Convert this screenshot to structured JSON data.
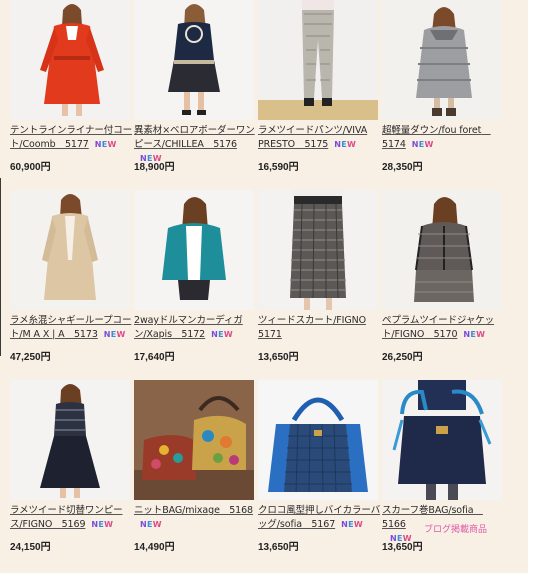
{
  "badge_text": "NEW",
  "colors": {
    "background": "#f8efe5",
    "link_text": "#2a2a2a",
    "new_badge": "#6a52c4",
    "blog_note": "#e05aa7"
  },
  "products": [
    {
      "title": "テントラインライナー付コート/Coomb　5177",
      "price": "60,900円",
      "has_new": true,
      "image": "red-coat"
    },
    {
      "title": "異素材×ベロアボーダーワンピース/CHILLEA　5176",
      "price": "18,900円",
      "has_new": true,
      "image": "navy-velour-dress"
    },
    {
      "title": "ラメツイードパンツ/VIVA PRESTO　5175",
      "price": "16,590円",
      "has_new": true,
      "image": "tweed-pants"
    },
    {
      "title": "超軽量ダウン/fou foret　5174",
      "price": "28,350円",
      "has_new": true,
      "image": "grey-down-coat"
    },
    {
      "title": "ラメ糸混シャギーループコート/M A X | A　5173",
      "price": "47,250円",
      "has_new": true,
      "image": "beige-coat"
    },
    {
      "title": "2wayドルマンカーディガン/Xapis　5172",
      "price": "17,640円",
      "has_new": true,
      "image": "teal-cardigan"
    },
    {
      "title": "ツィードスカート/FIGNO 5171",
      "price": "13,650円",
      "has_new": false,
      "image": "tweed-skirt"
    },
    {
      "title": "ペプラムツイードジャケット/FIGNO　5170",
      "price": "26,250円",
      "has_new": true,
      "image": "tweed-jacket"
    },
    {
      "title": "ラメツイード切替ワンピース/FIGNO　5169",
      "price": "24,150円",
      "has_new": true,
      "image": "tweed-dress"
    },
    {
      "title": "ニットBAG/mixage　5168",
      "price": "14,490円",
      "has_new": true,
      "image": "knit-bag"
    },
    {
      "title": "クロコ風型押しバイカラーバッグ/sofia　5167",
      "price": "13,650円",
      "has_new": true,
      "image": "blue-croc-bag"
    },
    {
      "title": "スカーフ巻BAG/sofia　5166",
      "price": "13,650円",
      "has_new": true,
      "blog_note": "ブログ掲載商品",
      "image": "navy-scarf-bag"
    }
  ]
}
